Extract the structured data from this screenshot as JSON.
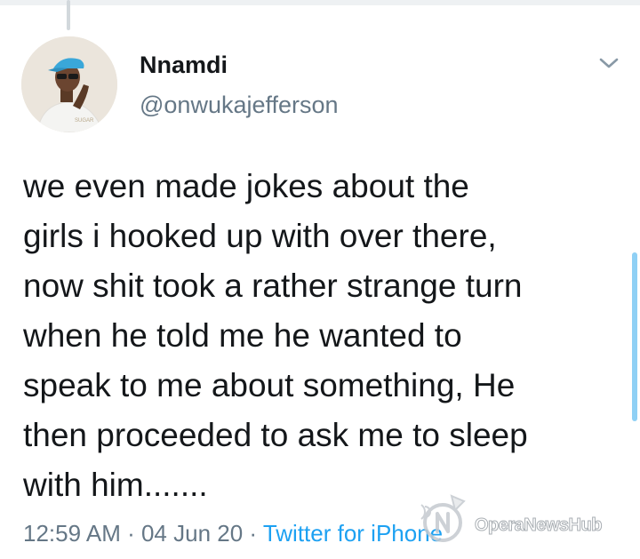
{
  "tweet": {
    "author": {
      "display_name": "Nnamdi",
      "handle": "@onwukajefferson",
      "avatar_shirt_text": "SUGAR"
    },
    "text": "we even made jokes about the\ngirls i hooked up with over there,\nnow shit took a rather strange turn\nwhen he told me he wanted to\nspeak to me about something, He\nthen proceeded to ask me to sleep\nwith him.......",
    "time": "12:59 AM",
    "separator": " · ",
    "date": "04 Jun 20",
    "source": "Twitter for iPhone"
  },
  "watermark": {
    "text": "OperaNewsHub"
  },
  "colors": {
    "text": "#14171a",
    "secondary": "#657786",
    "link": "#1da1f2",
    "thread_line": "#d2d8dc"
  }
}
